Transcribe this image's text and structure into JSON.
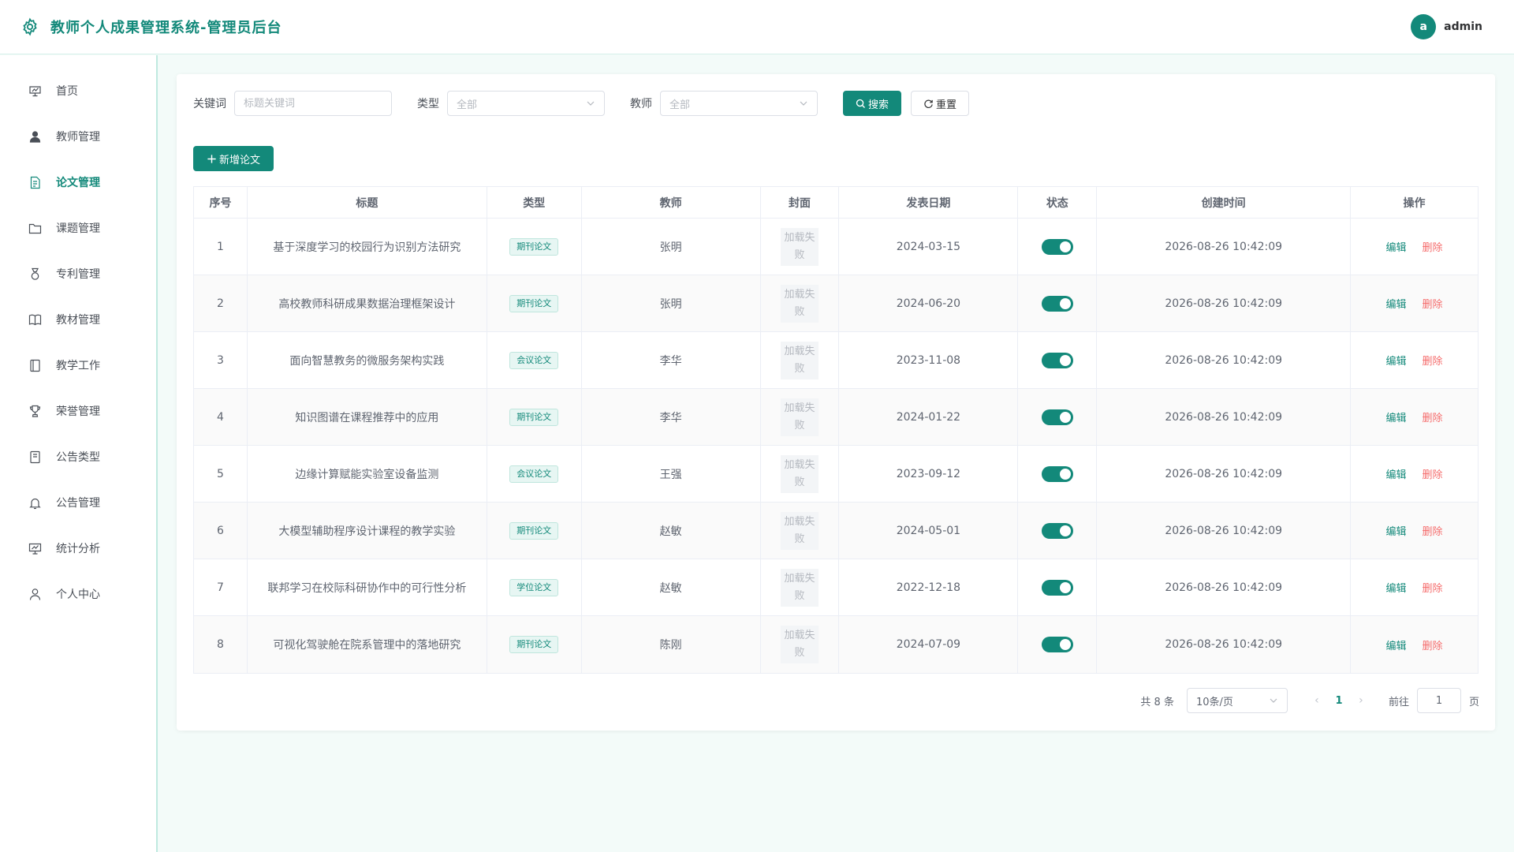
{
  "header": {
    "title": "教师个人成果管理系统-管理员后台",
    "user": {
      "avatar_letter": "a",
      "name": "admin"
    }
  },
  "sidebar": {
    "items": [
      {
        "label": "首页",
        "icon": "dashboard-icon",
        "active": false
      },
      {
        "label": "教师管理",
        "icon": "user-icon",
        "active": false
      },
      {
        "label": "论文管理",
        "icon": "document-icon",
        "active": true
      },
      {
        "label": "课题管理",
        "icon": "folder-icon",
        "active": false
      },
      {
        "label": "专利管理",
        "icon": "medal-icon",
        "active": false
      },
      {
        "label": "教材管理",
        "icon": "book-icon",
        "active": false
      },
      {
        "label": "教学工作",
        "icon": "notebook-icon",
        "active": false
      },
      {
        "label": "荣誉管理",
        "icon": "trophy-icon",
        "active": false
      },
      {
        "label": "公告类型",
        "icon": "tickets-icon",
        "active": false
      },
      {
        "label": "公告管理",
        "icon": "bell-icon",
        "active": false
      },
      {
        "label": "统计分析",
        "icon": "chart-icon",
        "active": false
      },
      {
        "label": "个人中心",
        "icon": "person-icon",
        "active": false
      }
    ]
  },
  "filters": {
    "keyword_label": "关键词",
    "keyword_placeholder": "标题关键词",
    "type_label": "类型",
    "type_value": "全部",
    "teacher_label": "教师",
    "teacher_value": "全部",
    "search_label": "搜索",
    "reset_label": "重置"
  },
  "toolbar": {
    "add_label": "新增论文"
  },
  "table": {
    "columns": [
      "序号",
      "标题",
      "类型",
      "教师",
      "封面",
      "发表日期",
      "状态",
      "创建时间",
      "操作"
    ],
    "cover_text": "加载失败",
    "edit_label": "编辑",
    "delete_label": "删除",
    "rows": [
      {
        "idx": "1",
        "title": "基于深度学习的校园行为识别方法研究",
        "type": "期刊论文",
        "teacher": "张明",
        "date": "2024-03-15",
        "status_on": true,
        "created": "2026-08-26 10:42:09"
      },
      {
        "idx": "2",
        "title": "高校教师科研成果数据治理框架设计",
        "type": "期刊论文",
        "teacher": "张明",
        "date": "2024-06-20",
        "status_on": true,
        "created": "2026-08-26 10:42:09"
      },
      {
        "idx": "3",
        "title": "面向智慧教务的微服务架构实践",
        "type": "会议论文",
        "teacher": "李华",
        "date": "2023-11-08",
        "status_on": true,
        "created": "2026-08-26 10:42:09"
      },
      {
        "idx": "4",
        "title": "知识图谱在课程推荐中的应用",
        "type": "期刊论文",
        "teacher": "李华",
        "date": "2024-01-22",
        "status_on": true,
        "created": "2026-08-26 10:42:09"
      },
      {
        "idx": "5",
        "title": "边缘计算赋能实验室设备监测",
        "type": "会议论文",
        "teacher": "王强",
        "date": "2023-09-12",
        "status_on": true,
        "created": "2026-08-26 10:42:09"
      },
      {
        "idx": "6",
        "title": "大模型辅助程序设计课程的教学实验",
        "type": "期刊论文",
        "teacher": "赵敏",
        "date": "2024-05-01",
        "status_on": true,
        "created": "2026-08-26 10:42:09"
      },
      {
        "idx": "7",
        "title": "联邦学习在校际科研协作中的可行性分析",
        "type": "学位论文",
        "teacher": "赵敏",
        "date": "2022-12-18",
        "status_on": true,
        "created": "2026-08-26 10:42:09"
      },
      {
        "idx": "8",
        "title": "可视化驾驶舱在院系管理中的落地研究",
        "type": "期刊论文",
        "teacher": "陈刚",
        "date": "2024-07-09",
        "status_on": true,
        "created": "2026-08-26 10:42:09"
      }
    ]
  },
  "pagination": {
    "total_text": "共 8 条",
    "page_size": "10条/页",
    "current_page": "1",
    "goto_label": "前往",
    "goto_value": "1",
    "page_suffix": "页"
  },
  "colors": {
    "primary": "#13897a",
    "danger": "#f56c6c",
    "background": "#f3fbf9"
  }
}
